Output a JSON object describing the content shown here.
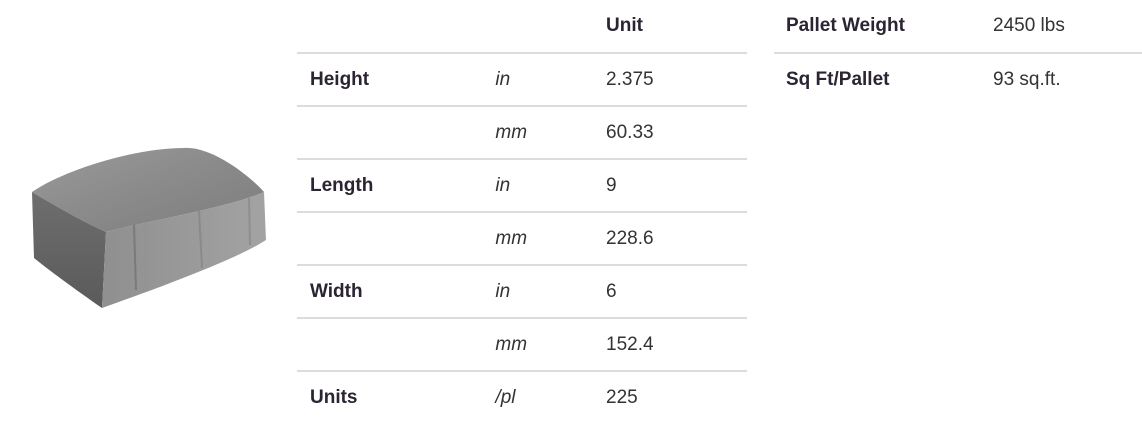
{
  "product": {
    "image_name": "paver-block-image"
  },
  "spec_table": {
    "header": {
      "col_label": "",
      "col_unit": "",
      "col_value": "Unit"
    },
    "rows": [
      {
        "label": "Height",
        "unit": "in",
        "value": "2.375"
      },
      {
        "label": "",
        "unit": "mm",
        "value": "60.33"
      },
      {
        "label": "Length",
        "unit": "in",
        "value": "9"
      },
      {
        "label": "",
        "unit": "mm",
        "value": "228.6"
      },
      {
        "label": "Width",
        "unit": "in",
        "value": "6"
      },
      {
        "label": "",
        "unit": "mm",
        "value": "152.4"
      },
      {
        "label": "Units",
        "unit": "/pl",
        "value": "225"
      }
    ]
  },
  "pallet_table": {
    "rows": [
      {
        "label": "Pallet Weight",
        "value": "2450 lbs"
      },
      {
        "label": "Sq Ft/Pallet",
        "value": "93 sq.ft."
      }
    ]
  }
}
